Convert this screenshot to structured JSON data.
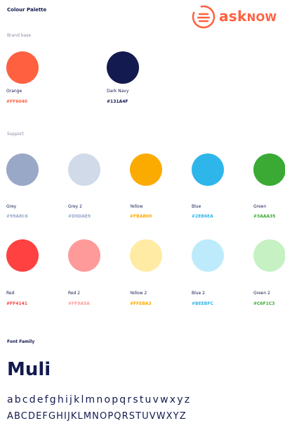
{
  "page_title": "Colour Palette",
  "logo": {
    "text_main": "ask",
    "text_tail": "now",
    "color": "#FF6040"
  },
  "brand_base": {
    "label": "Brand base",
    "swatches": [
      {
        "name": "Orange",
        "hex": "#FF6040",
        "color": "#FF6040",
        "text_color": "#FF6040"
      },
      {
        "name": "Dark Navy",
        "hex": "#131A4F",
        "color": "#131A4F",
        "text_color": "#131A4F"
      }
    ]
  },
  "support": {
    "label": "Support",
    "row1": [
      {
        "name": "Grey",
        "hex": "#99A8C6",
        "color": "#99A8C6",
        "text_color": "#99A8C6"
      },
      {
        "name": "Grey 2",
        "hex": "#D0DAE9",
        "color": "#D0DAE9",
        "text_color": "#99A8C6"
      },
      {
        "name": "Yellow",
        "hex": "#FBAB00",
        "color": "#FBAB00",
        "text_color": "#FBAB00"
      },
      {
        "name": "Blue",
        "hex": "#2EB6EA",
        "color": "#2EB6EA",
        "text_color": "#2EB6EA"
      },
      {
        "name": "Green",
        "hex": "#3AAA35",
        "color": "#3AAA35",
        "text_color": "#3AAA35"
      }
    ],
    "row2": [
      {
        "name": "Red",
        "hex": "#FF4141",
        "color": "#FF4141",
        "text_color": "#FF4141"
      },
      {
        "name": "Red 2",
        "hex": "#FF9A9A",
        "color": "#FF9A9A",
        "text_color": "#FF9A9A"
      },
      {
        "name": "Yellow 2",
        "hex": "#FFEBA3",
        "color": "#FFEBA3",
        "text_color": "#FBAB00"
      },
      {
        "name": "Blue 2",
        "hex": "#BEEBFC",
        "color": "#BEEBFC",
        "text_color": "#2EB6EA"
      },
      {
        "name": "Green 2",
        "hex": "#C6F1C3",
        "color": "#C6F1C3",
        "text_color": "#3AAA35"
      }
    ]
  },
  "font_family": {
    "label": "Font Family",
    "name": "Muli",
    "lowercase": "abcdefghijklmnopqrstuvwxyz",
    "uppercase": "ABCDEFGHIJKLMNOPQRSTUVWXYZ"
  }
}
